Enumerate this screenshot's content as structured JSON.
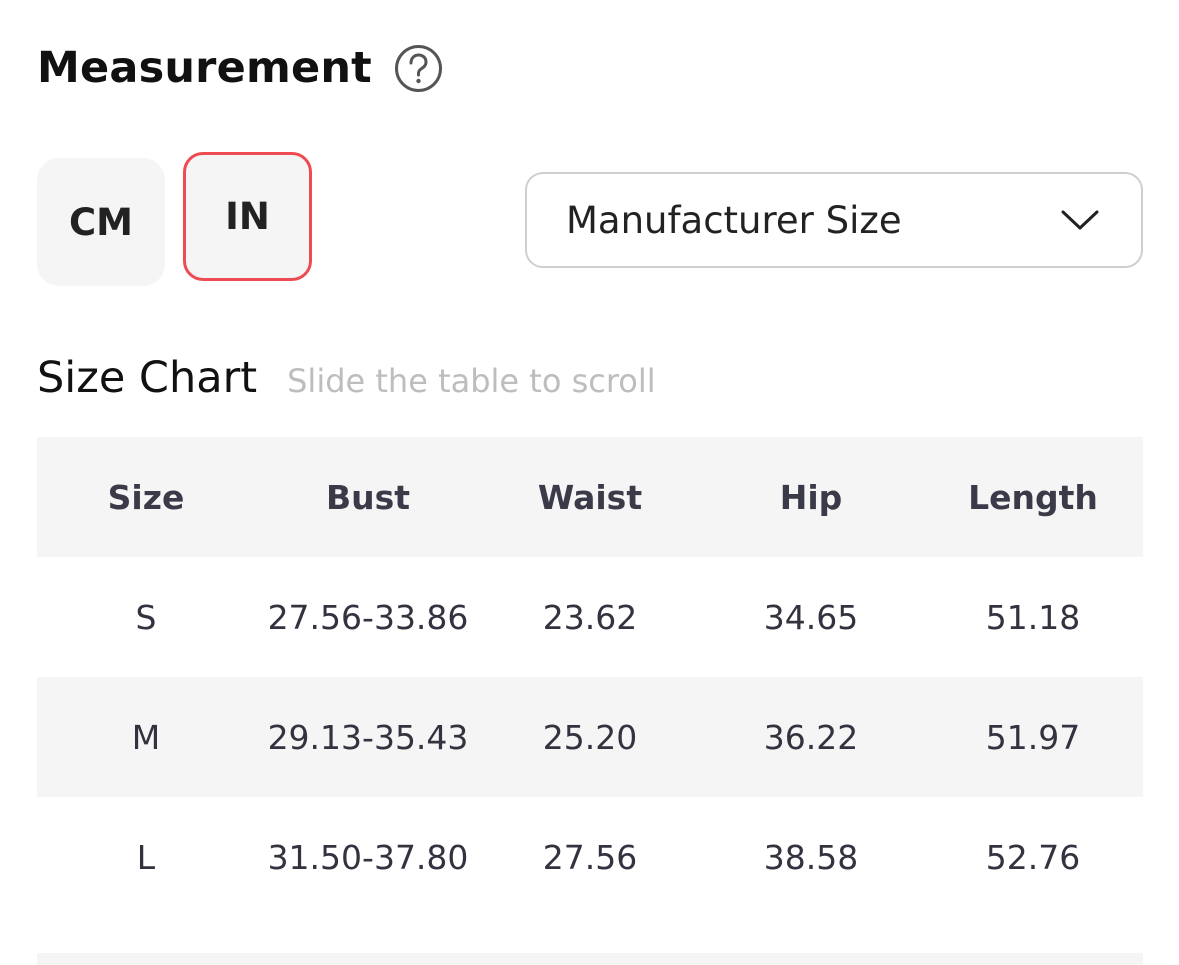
{
  "measurement": {
    "title": "Measurement",
    "help_icon": "question-circle-icon"
  },
  "units": {
    "options": [
      "CM",
      "IN"
    ],
    "selected": "IN",
    "accent_color": "#ef4b52"
  },
  "size_type_select": {
    "value": "Manufacturer Size",
    "icon": "chevron-down-icon"
  },
  "size_chart": {
    "title": "Size Chart",
    "hint": "Slide the table to scroll",
    "columns": [
      "Size",
      "Bust",
      "Waist",
      "Hip",
      "Length"
    ],
    "rows": [
      [
        "S",
        "27.56-33.86",
        "23.62",
        "34.65",
        "51.18"
      ],
      [
        "M",
        "29.13-35.43",
        "25.20",
        "36.22",
        "51.97"
      ],
      [
        "L",
        "31.50-37.80",
        "27.56",
        "38.58",
        "52.76"
      ]
    ]
  }
}
